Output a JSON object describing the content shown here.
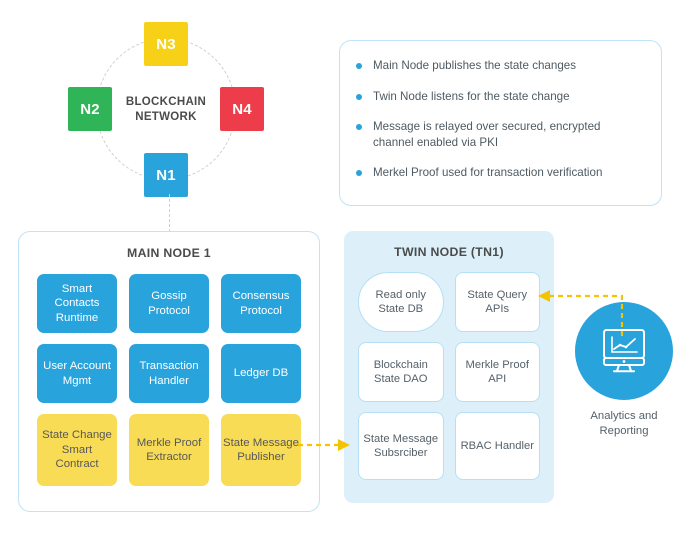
{
  "network": {
    "label": "BLOCKCHAIN\nNETWORK",
    "label_line1": "BLOCKCHAIN",
    "label_line2": "NETWORK",
    "nodes": [
      {
        "id": "n3",
        "label": "N3",
        "color": "#f7d117"
      },
      {
        "id": "n2",
        "label": "N2",
        "color": "#2fb457"
      },
      {
        "id": "n4",
        "label": "N4",
        "color": "#ee3d4a"
      },
      {
        "id": "n1",
        "label": "N1",
        "color": "#29a3dc"
      }
    ]
  },
  "bullets": {
    "dot_color": "#29a3dc",
    "items": [
      "Main Node publishes the state changes",
      "Twin Node listens for the state change",
      "Message is relayed over secured, encrypted channel enabled via PKI",
      "Merkel Proof used for transaction verification"
    ]
  },
  "main_node": {
    "title": "MAIN NODE 1",
    "blue_color": "#29a3dc",
    "yellow_color": "#f8dc55",
    "cells": [
      {
        "label": "Smart Contacts Runtime",
        "style": "blue"
      },
      {
        "label": "Gossip Protocol",
        "style": "blue"
      },
      {
        "label": "Consensus Protocol",
        "style": "blue"
      },
      {
        "label": "User Account Mgmt",
        "style": "blue"
      },
      {
        "label": "Transaction Handler",
        "style": "blue"
      },
      {
        "label": "Ledger DB",
        "style": "blue"
      },
      {
        "label": "State Change Smart Contract",
        "style": "yellow"
      },
      {
        "label": "Merkle Proof Extractor",
        "style": "yellow"
      },
      {
        "label": "State Message Publisher",
        "style": "yellow"
      }
    ]
  },
  "twin_node": {
    "title": "TWIN NODE (TN1)",
    "panel_color": "#ddf0fa",
    "cells": [
      {
        "label": "Read only State DB",
        "shape": "pill"
      },
      {
        "label": "State Query APIs",
        "shape": "rounded"
      },
      {
        "label": "Blockchain State DAO",
        "shape": "rounded"
      },
      {
        "label": "Merkle Proof API",
        "shape": "rounded"
      },
      {
        "label": "State Message Subsrciber",
        "shape": "rounded"
      },
      {
        "label": "RBAC Handler",
        "shape": "rounded"
      }
    ]
  },
  "analytics": {
    "label_line1": "Analytics and",
    "label_line2": "Reporting",
    "icon": "monitor-chart-icon",
    "circle_color": "#29a3dc"
  },
  "arrows": {
    "color": "#f5c400",
    "publisher_to_subscriber": "State Message Publisher to State Message Subsrciber",
    "analytics_to_state_query": "Analytics and Reporting to State Query APIs"
  }
}
